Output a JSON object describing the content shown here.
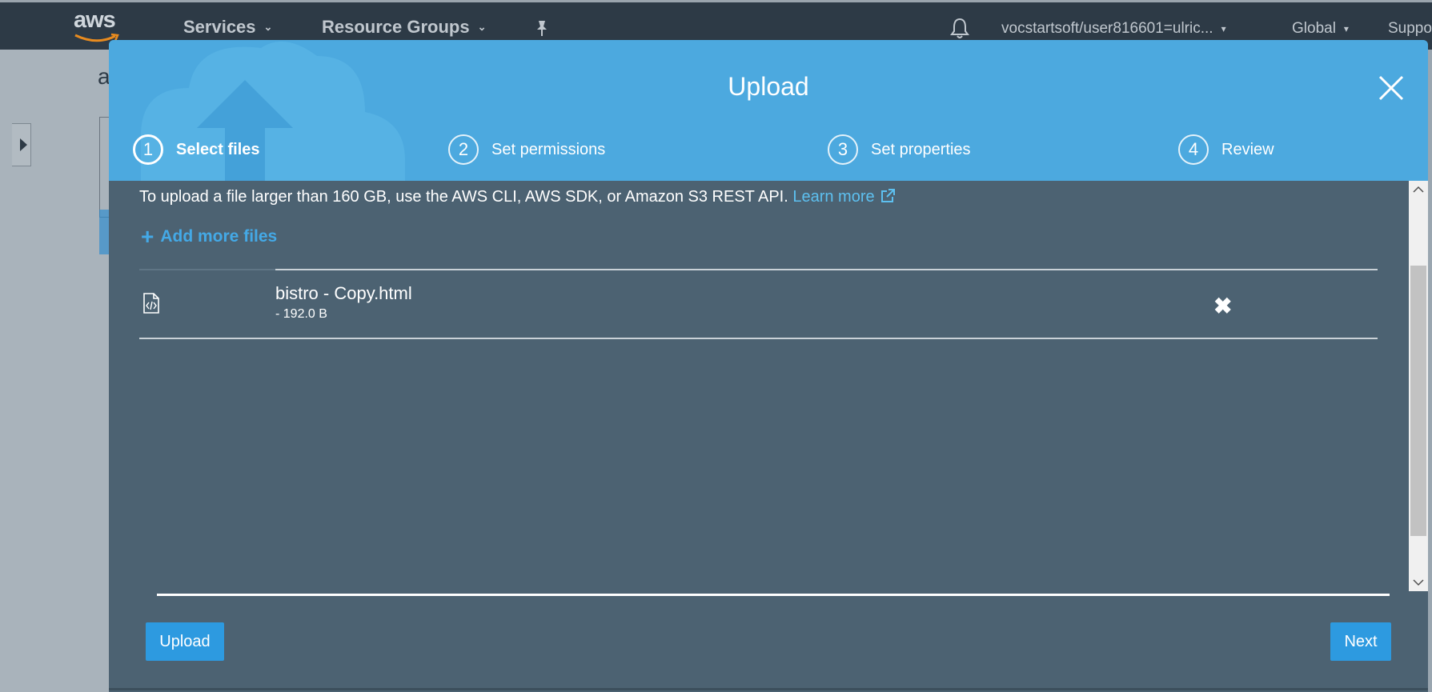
{
  "topnav": {
    "logo": "aws",
    "services": "Services",
    "resource_groups": "Resource Groups",
    "account": "vocstartsoft/user816601=ulric...",
    "region": "Global",
    "support": "Suppo"
  },
  "background": {
    "letter": "a"
  },
  "modal": {
    "title": "Upload",
    "steps": [
      {
        "num": "1",
        "label": "Select files"
      },
      {
        "num": "2",
        "label": "Set permissions"
      },
      {
        "num": "3",
        "label": "Set properties"
      },
      {
        "num": "4",
        "label": "Review"
      }
    ],
    "info_text": "To upload a file larger than 160 GB, use the AWS CLI, AWS SDK, or Amazon S3 REST API.",
    "learn_more": "Learn more",
    "add_more_files": "Add more files",
    "files": [
      {
        "name": "bistro - Copy.html",
        "size": "- 192.0 B"
      }
    ],
    "upload_button": "Upload",
    "next_button": "Next"
  },
  "colors": {
    "header_blue": "#4ca9df",
    "body_slate": "#4c6272",
    "button_blue": "#2d9ae0",
    "link_blue": "#5dc0f0"
  },
  "icons": [
    "aws-logo-icon",
    "chevron-down-icon",
    "pin-icon",
    "bell-icon",
    "close-icon",
    "cloud-upload-icon",
    "external-link-icon",
    "plus-icon",
    "file-code-icon",
    "remove-icon"
  ]
}
